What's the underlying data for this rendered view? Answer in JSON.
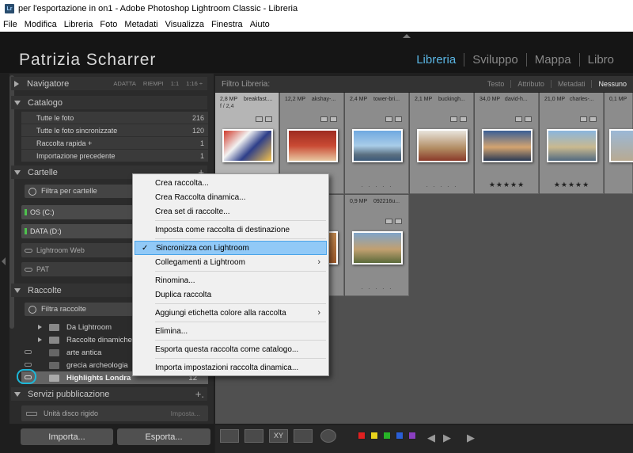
{
  "window": {
    "title": "per l'esportazione in on1 - Adobe Photoshop Lightroom Classic - Libreria",
    "logo": "Lr"
  },
  "menu": [
    "File",
    "Modifica",
    "Libreria",
    "Foto",
    "Metadati",
    "Visualizza",
    "Finestra",
    "Aiuto"
  ],
  "identity": "Patrizia Scharrer",
  "modules": [
    {
      "label": "Libreria",
      "active": true
    },
    {
      "label": "Sviluppo",
      "active": false
    },
    {
      "label": "Mappa",
      "active": false
    },
    {
      "label": "Libro",
      "active": false
    }
  ],
  "left_panel": {
    "navigator": {
      "label": "Navigatore",
      "options": [
        "ADATTA",
        "RIEMPI",
        "1:1",
        "1:16 ÷"
      ]
    },
    "catalog": {
      "label": "Catalogo",
      "rows": [
        {
          "label": "Tutte le foto",
          "count": "216"
        },
        {
          "label": "Tutte le foto sincronizzate",
          "count": "120"
        },
        {
          "label": "Raccolta rapida +",
          "count": "1"
        },
        {
          "label": "Importazione precedente",
          "count": "1"
        }
      ]
    },
    "folders": {
      "label": "Cartelle",
      "plus": "+",
      "filter": "Filtra per cartelle",
      "volumes": [
        "OS (C:)",
        "DATA (D:)",
        "Lightroom Web",
        "PAT"
      ]
    },
    "collections": {
      "label": "Raccolte",
      "filter": "Filtra raccolte",
      "items": [
        {
          "label": "Da Lightroom",
          "count": ""
        },
        {
          "label": "Raccolte dinamiche",
          "count": ""
        },
        {
          "label": "arte antica",
          "count": ""
        },
        {
          "label": "grecia archeologia",
          "count": ""
        },
        {
          "label": "Highlights Londra",
          "count": "12"
        }
      ]
    },
    "publish": {
      "label": "Servizi pubblicazione",
      "plus": "+.",
      "row_label": "Unità disco rigido",
      "row_action": "Imposta..."
    },
    "buttons": {
      "import": "Importa...",
      "export": "Esporta..."
    }
  },
  "filter_bar": {
    "title": "Filtro Libreria:",
    "tabs": [
      {
        "label": "Testo",
        "on": false
      },
      {
        "label": "Attributo",
        "on": false
      },
      {
        "label": "Metadati",
        "on": false
      },
      {
        "label": "Nessuno",
        "on": true
      }
    ]
  },
  "grid": {
    "cells": [
      {
        "size": "2,8 MP",
        "name": "breakfast....",
        "sub": "f / 2,4",
        "stars": "· · · · ·",
        "rated": false,
        "selected": true
      },
      {
        "size": "12,2 MP",
        "name": "akshay-...",
        "sub": "",
        "stars": "· · · · ·",
        "rated": false,
        "selected": false
      },
      {
        "size": "2,4 MP",
        "name": "tower-bri...",
        "sub": "",
        "stars": "· · · · ·",
        "rated": false,
        "selected": false
      },
      {
        "size": "2,1 MP",
        "name": "buckingh...",
        "sub": "",
        "stars": "· · · · ·",
        "rated": false,
        "selected": false
      },
      {
        "size": "34,0 MP",
        "name": "david-h...",
        "sub": "",
        "stars": "★★★★★",
        "rated": true,
        "selected": false
      },
      {
        "size": "21,0 MP",
        "name": "charles-...",
        "sub": "",
        "stars": "★★★★★",
        "rated": true,
        "selected": false
      },
      {
        "size": "0,1 MP",
        "name": "",
        "sub": "",
        "stars": "· · · · ·",
        "rated": false,
        "selected": false
      },
      {
        "size": "",
        "name": "",
        "sub": "",
        "stars": "· · · · ·",
        "rated": false,
        "selected": false
      },
      {
        "size": "",
        "name": "",
        "sub": "",
        "stars": "· · · · ·",
        "rated": false,
        "selected": false
      },
      {
        "size": "0,9 MP",
        "name": "092216u...",
        "sub": "",
        "stars": "· · · · ·",
        "rated": false,
        "selected": false
      }
    ]
  },
  "context_menu": {
    "items": [
      {
        "label": "Crea raccolta...",
        "checked": false,
        "submenu": false,
        "highlight": false
      },
      {
        "label": "Crea Raccolta dinamica...",
        "checked": false,
        "submenu": false,
        "highlight": false
      },
      {
        "label": "Crea set di raccolte...",
        "checked": false,
        "submenu": false,
        "highlight": false
      },
      {
        "label": "Imposta come raccolta di destinazione",
        "checked": false,
        "submenu": false,
        "highlight": false
      },
      {
        "label": "Sincronizza con Lightroom",
        "checked": true,
        "submenu": false,
        "highlight": true
      },
      {
        "label": "Collegamenti a Lightroom",
        "checked": false,
        "submenu": true,
        "highlight": false
      },
      {
        "label": "Rinomina...",
        "checked": false,
        "submenu": false,
        "highlight": false
      },
      {
        "label": "Duplica raccolta",
        "checked": false,
        "submenu": false,
        "highlight": false
      },
      {
        "label": "Aggiungi etichetta colore alla raccolta",
        "checked": false,
        "submenu": true,
        "highlight": false
      },
      {
        "label": "Elimina...",
        "checked": false,
        "submenu": false,
        "highlight": false
      },
      {
        "label": "Esporta questa raccolta come catalogo...",
        "checked": false,
        "submenu": false,
        "highlight": false
      },
      {
        "label": "Importa impostazioni raccolta dinamica...",
        "checked": false,
        "submenu": false,
        "highlight": false
      }
    ],
    "check_glyph": "✓",
    "submenu_glyph": "›"
  },
  "toolbar": {
    "view_icons": [
      "grid-view-icon",
      "loupe-view-icon",
      "compare-view-icon",
      "survey-view-icon",
      "people-view-icon"
    ],
    "compare_label": "XY",
    "color_labels": [
      "#e02020",
      "#e8d21c",
      "#27b327",
      "#2a5fd6",
      "#8a3fc0"
    ],
    "nav": {
      "prev": "◀",
      "next": "▶",
      "play": "▶"
    }
  },
  "colors": {
    "accent": "#5ab6e4",
    "highlight_ring": "#1cb7d8",
    "menu_highlight": "#91c9f7"
  }
}
